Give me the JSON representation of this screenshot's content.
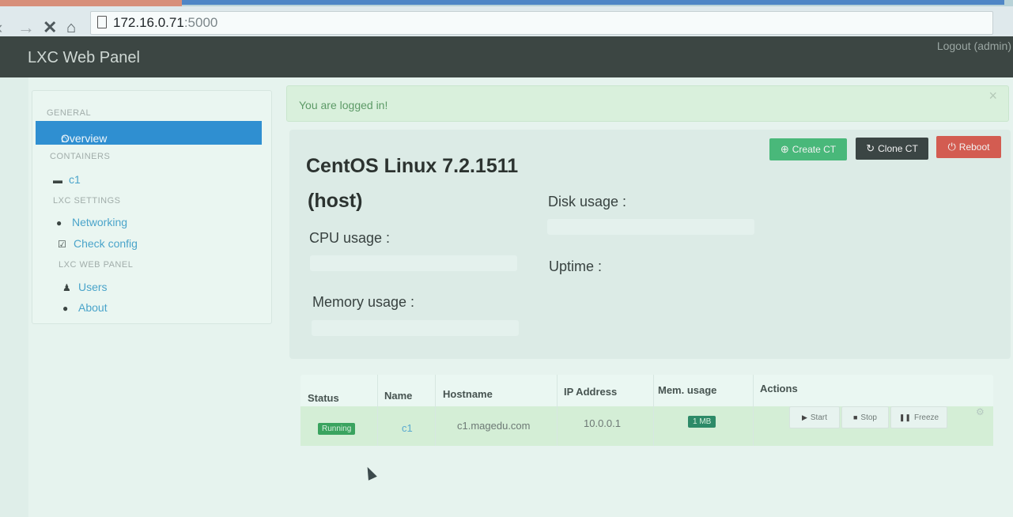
{
  "browser": {
    "url_host": "172.16.0.71",
    "url_port": ":5000",
    "back_icon": "back-arrow-icon",
    "forward_icon": "forward-arrow-icon",
    "stop_icon": "close-icon",
    "home_icon": "home-icon"
  },
  "navbar": {
    "brand": "LXC Web Panel",
    "logout": "Logout (admin)"
  },
  "sidebar": {
    "sections": [
      {
        "header": "GENERAL",
        "items": [
          {
            "label": "Overview",
            "icon": "home-icon",
            "active": true
          }
        ]
      },
      {
        "header": "CONTAINERS",
        "items": [
          {
            "label": "c1",
            "icon": "container-icon"
          }
        ]
      },
      {
        "header": "LXC SETTINGS",
        "items": [
          {
            "label": "Networking",
            "icon": "globe-icon"
          },
          {
            "label": "Check config",
            "icon": "check-icon"
          }
        ]
      },
      {
        "header": "LXC WEB PANEL",
        "items": [
          {
            "label": "Users",
            "icon": "user-icon"
          },
          {
            "label": "About",
            "icon": "info-icon"
          }
        ]
      }
    ]
  },
  "alert": {
    "text": "You are logged in!",
    "close": "×"
  },
  "host": {
    "title": "CentOS Linux 7.2.1511",
    "subtitle": "(host)",
    "cpu_label": "CPU usage :",
    "memory_label": "Memory usage :",
    "disk_label": "Disk usage :",
    "uptime_label": "Uptime :",
    "buttons": {
      "create": "Create CT",
      "clone": "Clone CT",
      "reboot": "Reboot"
    }
  },
  "table": {
    "headers": [
      "Status",
      "Name",
      "Hostname",
      "IP Address",
      "Mem. usage",
      "Actions"
    ],
    "rows": [
      {
        "status": "Running",
        "name": "c1",
        "hostname": "c1.magedu.com",
        "ip": "10.0.0.1",
        "mem": "1 MB",
        "actions": {
          "start": "Start",
          "stop": "Stop",
          "freeze": "Freeze"
        }
      }
    ]
  },
  "colors": {
    "navbar": "#3c4643",
    "active": "#2f8fd1",
    "create": "#49b87a",
    "clone": "#3b4544",
    "reboot": "#d35c51",
    "running": "#3aa35f"
  }
}
